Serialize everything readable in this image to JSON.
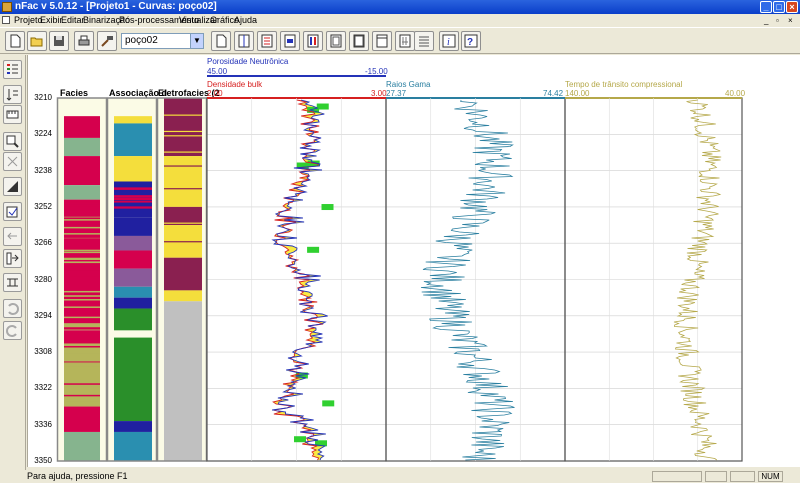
{
  "window": {
    "title": "nFac v 5.0.12 - [Projeto1 - Curvas: poço02]"
  },
  "menu": {
    "items": [
      "Projeto",
      "Exibir",
      "Editar",
      "Binarização",
      "Pós-processamento",
      "Visualizar",
      "Gráfico",
      "Ajuda"
    ]
  },
  "toolbar": {
    "well_selected": "poço02"
  },
  "track_headers": {
    "facies": "Facies",
    "associacao": "Associação d",
    "eletrofacies": "Eletrofacies (2"
  },
  "curves": {
    "porosidade": {
      "name": "Porosidade Neutrônica",
      "min": "45.00",
      "max": "-15.00",
      "color": "#2433b8"
    },
    "densidade": {
      "name": "Densidade bulk",
      "min": "2.00",
      "max": "3.00",
      "color": "#d62020"
    },
    "raios_gama": {
      "name": "Raios Gama",
      "min": "27.37",
      "max": "74.42",
      "color": "#2a7fa0"
    },
    "tempo": {
      "name": "Tempo de trânsito compressional",
      "min": "140.00",
      "max": "40.00",
      "color": "#b5a84a"
    }
  },
  "depth_ticks": [
    "3210",
    "3224",
    "3238",
    "3252",
    "3266",
    "3280",
    "3294",
    "3308",
    "3322",
    "3336",
    "3350"
  ],
  "status": {
    "help": "Para ajuda, pressione F1",
    "mode": "NUM"
  },
  "colors": {
    "green": "#86b48e",
    "red": "#d5004d",
    "olive": "#b5b55a",
    "teal": "#2a8fb0",
    "yellow": "#f4de3c",
    "navy": "#2020a0",
    "grey": "#c0c0c0",
    "purple": "#8a2050"
  }
}
